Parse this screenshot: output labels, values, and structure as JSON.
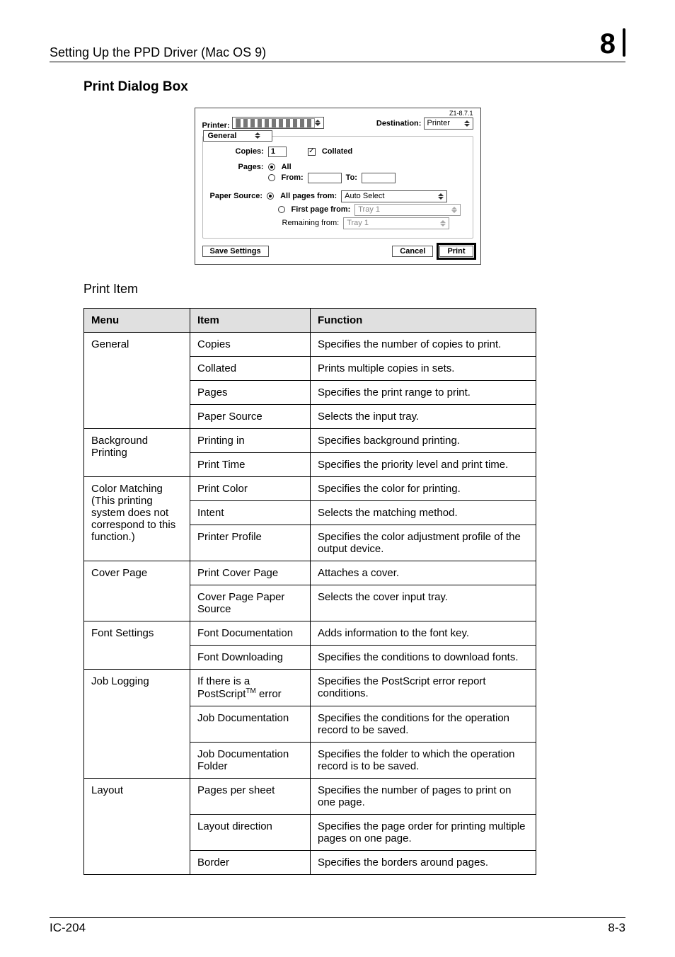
{
  "header": {
    "running_head": "Setting Up the PPD Driver (Mac OS 9)",
    "chapter_number": "8"
  },
  "section_title": "Print Dialog Box",
  "subsection_title": "Print Item",
  "dialog": {
    "version": "Z1-8.7.1",
    "printer_label": "Printer:",
    "destination_label": "Destination:",
    "destination_value": "Printer",
    "panel_name": "General",
    "copies_label": "Copies:",
    "copies_value": "1",
    "collated_label": "Collated",
    "pages_label": "Pages:",
    "pages_all_label": "All",
    "pages_from_label": "From:",
    "pages_to_label": "To:",
    "paper_source_label": "Paper Source:",
    "all_pages_from_label": "All pages from:",
    "all_pages_from_value": "Auto Select",
    "first_page_from_label": "First page from:",
    "first_page_from_value": "Tray 1",
    "remaining_from_label": "Remaining from:",
    "remaining_from_value": "Tray 1",
    "save_settings_btn": "Save Settings",
    "cancel_btn": "Cancel",
    "print_btn": "Print"
  },
  "table": {
    "headers": {
      "menu": "Menu",
      "item": "Item",
      "function": "Function"
    },
    "groups": [
      {
        "menu": "General",
        "rows": [
          {
            "item": "Copies",
            "func": "Specifies the number of copies to print."
          },
          {
            "item": "Collated",
            "func": "Prints multiple copies in sets."
          },
          {
            "item": "Pages",
            "func": "Specifies the print range to print."
          },
          {
            "item": "Paper Source",
            "func": "Selects the input tray."
          }
        ]
      },
      {
        "menu": "Background Printing",
        "rows": [
          {
            "item": "Printing in",
            "func": "Specifies background printing."
          },
          {
            "item": "Print Time",
            "func": "Specifies the priority level and print time."
          }
        ]
      },
      {
        "menu": "Color Matching\n(This printing system does not correspond to this function.)",
        "rows": [
          {
            "item": "Print Color",
            "func": "Specifies the color for printing."
          },
          {
            "item": "Intent",
            "func": "Selects the matching method."
          },
          {
            "item": "Printer Profile",
            "func": "Specifies the color adjustment profile of the output device."
          }
        ]
      },
      {
        "menu": "Cover Page",
        "rows": [
          {
            "item": "Print Cover Page",
            "func": "Attaches a cover."
          },
          {
            "item": "Cover Page Paper Source",
            "func": "Selects the cover input tray."
          }
        ]
      },
      {
        "menu": "Font Settings",
        "rows": [
          {
            "item": "Font Documentation",
            "func": "Adds information to the font key."
          },
          {
            "item": "Font Downloading",
            "func": "Specifies the conditions to download fonts."
          }
        ]
      },
      {
        "menu": "Job Logging",
        "rows": [
          {
            "item_html": "If there is a PostScript<sup>TM</sup> error",
            "func": "Specifies the PostScript error report conditions."
          },
          {
            "item": "Job Documentation",
            "func": "Specifies the conditions for the operation record to be saved."
          },
          {
            "item": "Job Documentation Folder",
            "func": "Specifies the folder to which the operation record is to be saved."
          }
        ]
      },
      {
        "menu": "Layout",
        "rows": [
          {
            "item": "Pages per sheet",
            "func": "Specifies the number of pages to print on one page."
          },
          {
            "item": "Layout direction",
            "func": "Specifies the page order for printing multiple pages on one page."
          },
          {
            "item": "Border",
            "func": "Specifies the borders around pages."
          }
        ]
      }
    ]
  },
  "footer": {
    "left": "IC-204",
    "right": "8-3"
  }
}
